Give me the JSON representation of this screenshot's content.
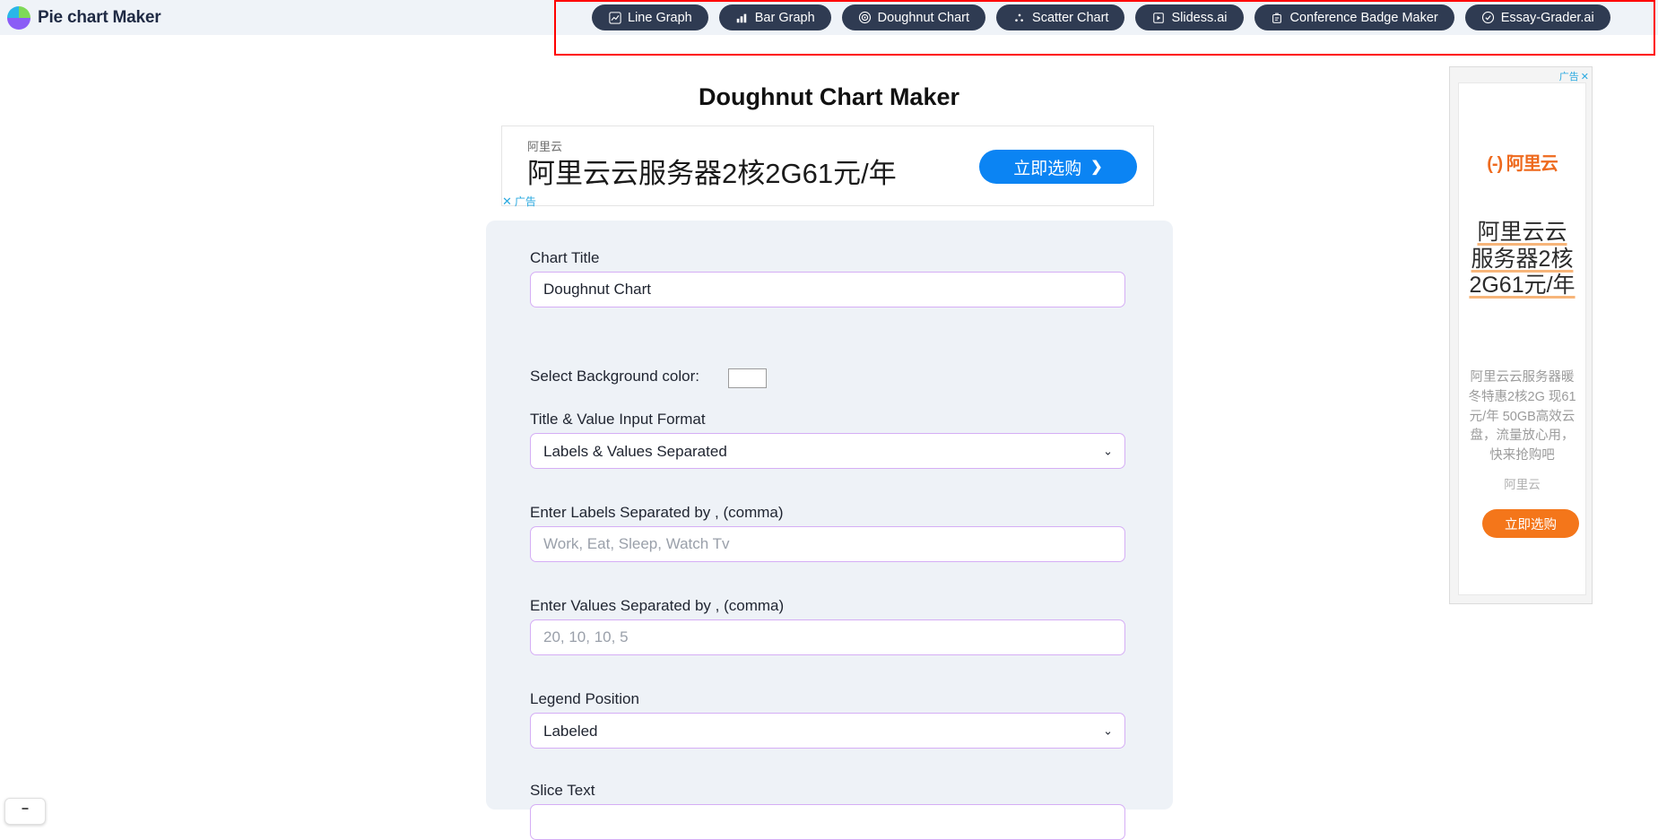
{
  "brand": {
    "title": "Pie chart Maker",
    "logo_icon": "pie-chart-logo-icon"
  },
  "nav": {
    "items": [
      {
        "label": "Line Graph",
        "icon": "line-chart-icon"
      },
      {
        "label": "Bar Graph",
        "icon": "bar-chart-icon"
      },
      {
        "label": "Doughnut Chart",
        "icon": "target-circle-icon"
      },
      {
        "label": "Scatter Chart",
        "icon": "scatter-dots-icon"
      },
      {
        "label": "Slidess.ai",
        "icon": "slide-play-icon"
      },
      {
        "label": "Conference Badge Maker",
        "icon": "badge-id-icon"
      },
      {
        "label": "Essay-Grader.ai",
        "icon": "check-circle-icon"
      }
    ],
    "highlight_color": "#ff0000"
  },
  "page": {
    "title": "Doughnut Chart Maker"
  },
  "leaderboard_ad": {
    "brand": "阿里云",
    "headline": "阿里云云服务器2核2G61元/年",
    "cta": "立即选购",
    "cta_chevron": "❯",
    "ad_label": "广告",
    "close_label": "✕",
    "cta_color": "#0b84f3"
  },
  "form": {
    "chart_title_label": "Chart Title",
    "chart_title_value": "Doughnut Chart",
    "chart_title_placeholder": "Chart Title",
    "bg_color_label": "Select Background color:",
    "bg_color_value": "#ffffff",
    "input_format_label": "Title & Value Input Format",
    "input_format_value": "Labels & Values Separated",
    "input_format_options": [
      "Labels & Values Separated"
    ],
    "labels_label": "Enter Labels Separated by , (comma)",
    "labels_value": "",
    "labels_placeholder": "Work, Eat, Sleep, Watch Tv",
    "values_label": "Enter Values Separated by , (comma)",
    "values_value": "",
    "values_placeholder": "20, 10, 10, 5",
    "legend_position_label": "Legend Position",
    "legend_position_value": "Labeled",
    "legend_position_options": [
      "Labeled"
    ],
    "slice_text_label": "Slice Text",
    "chevron": "⌄",
    "field_border_color": "#d5aef5"
  },
  "rail_ad": {
    "ad_label": "广告",
    "close_label": "✕",
    "logo_text": "(-) 阿里云",
    "headline": "阿里云云服务器2核2G61元/年",
    "description": "阿里云云服务器暖冬特惠2核2G 现61元/年 50GB高效云盘，流量放心用，快来抢购吧",
    "brand": "阿里云",
    "cta": "立即选购",
    "cta_color": "#f4761a"
  }
}
